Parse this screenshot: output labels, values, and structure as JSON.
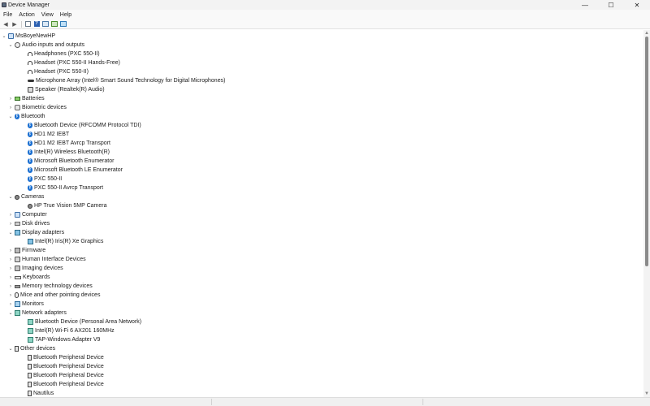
{
  "window": {
    "title": "Device Manager",
    "minimize": "—",
    "maximize": "☐",
    "close": "✕"
  },
  "menu": [
    "File",
    "Action",
    "View",
    "Help"
  ],
  "toolbar": {
    "back": "◀",
    "forward": "▶"
  },
  "tree": {
    "root": "MsBoyeNewHP",
    "expanded_glyph": "⌄",
    "collapsed_glyph": "›",
    "categories": [
      {
        "label": "Audio inputs and outputs",
        "icon": "audio-icon",
        "expanded": true,
        "children": [
          {
            "label": "Headphones (PXC 550-II)",
            "icon": "headphones-icon"
          },
          {
            "label": "Headset (PXC 550-II Hands-Free)",
            "icon": "headphones-icon"
          },
          {
            "label": "Headset (PXC 550-II)",
            "icon": "headphones-icon"
          },
          {
            "label": "Microphone Array (Intel® Smart Sound Technology for Digital Microphones)",
            "icon": "mic-icon"
          },
          {
            "label": "Speaker (Realtek(R) Audio)",
            "icon": "speaker-icon"
          }
        ]
      },
      {
        "label": "Batteries",
        "icon": "battery-icon",
        "expanded": false,
        "children": []
      },
      {
        "label": "Biometric devices",
        "icon": "bio-icon",
        "expanded": false,
        "children": []
      },
      {
        "label": "Bluetooth",
        "icon": "bt-icon",
        "expanded": true,
        "children": [
          {
            "label": "Bluetooth Device (RFCOMM Protocol TDI)",
            "icon": "bt-icon"
          },
          {
            "label": "HD1 M2 IEBT",
            "icon": "bt-icon"
          },
          {
            "label": "HD1 M2 IEBT Avrcp Transport",
            "icon": "bt-icon"
          },
          {
            "label": "Intel(R) Wireless Bluetooth(R)",
            "icon": "bt-icon"
          },
          {
            "label": "Microsoft Bluetooth Enumerator",
            "icon": "bt-icon"
          },
          {
            "label": "Microsoft Bluetooth LE Enumerator",
            "icon": "bt-icon"
          },
          {
            "label": "PXC 550-II",
            "icon": "bt-icon"
          },
          {
            "label": "PXC 550-II Avrcp Transport",
            "icon": "bt-icon"
          }
        ]
      },
      {
        "label": "Cameras",
        "icon": "camera-icon",
        "expanded": true,
        "children": [
          {
            "label": "HP True Vision 5MP Camera",
            "icon": "camera-icon"
          }
        ]
      },
      {
        "label": "Computer",
        "icon": "computer-icon",
        "expanded": false,
        "children": []
      },
      {
        "label": "Disk drives",
        "icon": "disk-icon",
        "expanded": false,
        "children": []
      },
      {
        "label": "Display adapters",
        "icon": "display-icon",
        "expanded": true,
        "children": [
          {
            "label": "Intel(R) Iris(R) Xe Graphics",
            "icon": "display-icon"
          }
        ]
      },
      {
        "label": "Firmware",
        "icon": "firmware-icon",
        "expanded": false,
        "children": []
      },
      {
        "label": "Human Interface Devices",
        "icon": "hid-icon",
        "expanded": false,
        "children": []
      },
      {
        "label": "Imaging devices",
        "icon": "imaging-icon",
        "expanded": false,
        "children": []
      },
      {
        "label": "Keyboards",
        "icon": "keyboard-icon",
        "expanded": false,
        "children": []
      },
      {
        "label": "Memory technology devices",
        "icon": "memory-icon",
        "expanded": false,
        "children": []
      },
      {
        "label": "Mice and other pointing devices",
        "icon": "mouse-icon",
        "expanded": false,
        "children": []
      },
      {
        "label": "Monitors",
        "icon": "monitor-icon",
        "expanded": false,
        "children": []
      },
      {
        "label": "Network adapters",
        "icon": "network-icon",
        "expanded": true,
        "children": [
          {
            "label": "Bluetooth Device (Personal Area Network)",
            "icon": "network-icon"
          },
          {
            "label": "Intel(R) Wi-Fi 6 AX201 160MHz",
            "icon": "network-icon"
          },
          {
            "label": "TAP-Windows Adapter V9",
            "icon": "network-icon"
          }
        ]
      },
      {
        "label": "Other devices",
        "icon": "other-icon",
        "expanded": true,
        "children": [
          {
            "label": "Bluetooth Peripheral Device",
            "icon": "other-icon"
          },
          {
            "label": "Bluetooth Peripheral Device",
            "icon": "other-icon"
          },
          {
            "label": "Bluetooth Peripheral Device",
            "icon": "other-icon"
          },
          {
            "label": "Bluetooth Peripheral Device",
            "icon": "other-icon"
          },
          {
            "label": "Nautilus",
            "icon": "other-icon"
          }
        ]
      }
    ]
  },
  "scrollbar": {
    "up": "▲",
    "down": "▼"
  }
}
